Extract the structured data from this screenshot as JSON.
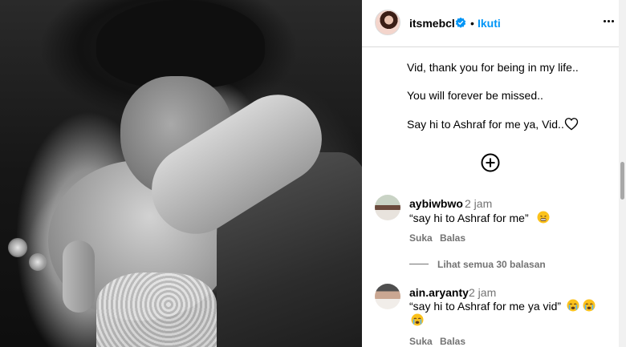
{
  "post": {
    "author": {
      "username": "itsmebcl",
      "verified": true,
      "separator": "•",
      "follow_label": "Ikuti"
    },
    "caption": [
      "Vid, thank you for being in my life..",
      "You will forever be missed..",
      "Say hi to Ashraf for me ya, Vid.."
    ],
    "icons": {
      "more": "more-options-icon",
      "heart": "heart-outline-icon",
      "load_more": "plus-circle-icon",
      "verified": "verified-badge-icon"
    }
  },
  "comments": [
    {
      "username": "aybiwbwo",
      "time": "2 jam",
      "text": "“say hi to Ashraf for me”",
      "emojis": [
        "😤"
      ],
      "like_label": "Suka",
      "reply_label": "Balas"
    },
    {
      "username": "ain.aryanty",
      "time": "2 jam",
      "text": "“say hi to Ashraf for me ya vid”",
      "emojis": [
        "😭",
        "😭",
        "😭"
      ],
      "like_label": "Suka",
      "reply_label": "Balas"
    }
  ],
  "replies": {
    "label": "Lihat semua 30 balasan"
  },
  "colors": {
    "accent": "#0095f6",
    "secondary_text": "#737373",
    "divider": "#dbdbdb"
  }
}
